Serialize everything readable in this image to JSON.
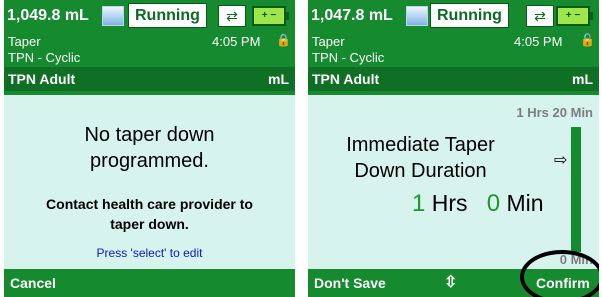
{
  "left_screen": {
    "volume": "1,049.8 mL",
    "status": "Running",
    "header": {
      "category": "Taper",
      "time": "4:05 PM",
      "therapy": "TPN - Cyclic",
      "protocol": "TPN Adult",
      "unit": "mL"
    },
    "message": {
      "line1": "No taper down",
      "line2": "programmed.",
      "instruction1": "Contact health care provider to",
      "instruction2": "taper down.",
      "hint": "Press 'select' to edit"
    },
    "softkey_left": "Cancel"
  },
  "right_screen": {
    "volume": "1,047.8 mL",
    "status": "Running",
    "header": {
      "category": "Taper",
      "time": "4:05 PM",
      "therapy": "TPN - Cyclic",
      "protocol": "TPN Adult",
      "unit": "mL"
    },
    "scale_max": {
      "value_hrs": "1",
      "unit_hrs": "Hrs",
      "value_min": "20",
      "unit_min": "Min"
    },
    "scale_min": "0 Min",
    "title_line1": "Immediate Taper",
    "title_line2": "Down Duration",
    "duration": {
      "hours": "1",
      "hours_unit": "Hrs",
      "minutes": "0",
      "minutes_unit": "Min"
    },
    "softkey_left": "Don't Save",
    "softkey_right": "Confirm"
  },
  "icons": {
    "vial": "syringe-vial-icon",
    "plug": "ac-power-plug-icon",
    "battery": "battery-icon",
    "lock": "padlock-icon",
    "arrow": "right-arrow-icon",
    "updown": "up-down-arrow-icon"
  },
  "colors": {
    "screen_bg": "#d6f3ee",
    "bar_green": "#168a2e",
    "accent_green": "#1c9a2a",
    "hint_blue": "#1414c8"
  }
}
